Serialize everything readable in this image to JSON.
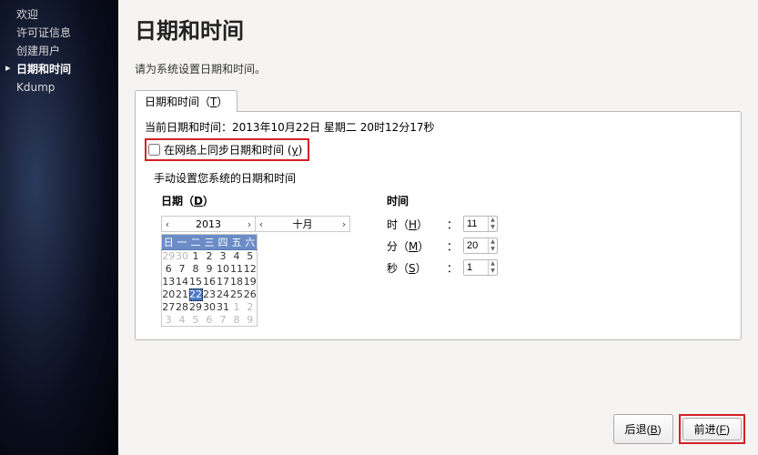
{
  "sidebar": {
    "items": [
      {
        "label": "欢迎"
      },
      {
        "label": "许可证信息"
      },
      {
        "label": "创建用户"
      },
      {
        "label": "日期和时间"
      },
      {
        "label": "Kdump"
      }
    ],
    "selected_index": 3
  },
  "page": {
    "title": "日期和时间",
    "instruction": "请为系统设置日期和时间。"
  },
  "tab": {
    "label": "日期和时间（T）",
    "hotkey": "T"
  },
  "current": {
    "label_prefix": "当前日期和时间：",
    "date": "2013年10月22日",
    "weekday": "星期二",
    "time": "20时12分17秒"
  },
  "sync": {
    "label": "在网络上同步日期和时间 (y)",
    "hotkey": "y",
    "checked": false
  },
  "manual": {
    "label": "手动设置您系统的日期和时间"
  },
  "date_section": {
    "heading": "日期（D）",
    "hotkey": "D",
    "year": "2013",
    "month": "十月",
    "dow": [
      "日",
      "一",
      "二",
      "三",
      "四",
      "五",
      "六"
    ],
    "weeks": [
      [
        {
          "d": 29,
          "o": true
        },
        {
          "d": 30,
          "o": true
        },
        {
          "d": 1
        },
        {
          "d": 2
        },
        {
          "d": 3
        },
        {
          "d": 4
        },
        {
          "d": 5
        }
      ],
      [
        {
          "d": 6
        },
        {
          "d": 7
        },
        {
          "d": 8
        },
        {
          "d": 9
        },
        {
          "d": 10
        },
        {
          "d": 11
        },
        {
          "d": 12
        }
      ],
      [
        {
          "d": 13
        },
        {
          "d": 14
        },
        {
          "d": 15
        },
        {
          "d": 16
        },
        {
          "d": 17
        },
        {
          "d": 18
        },
        {
          "d": 19
        }
      ],
      [
        {
          "d": 20
        },
        {
          "d": 21
        },
        {
          "d": 22,
          "t": true
        },
        {
          "d": 23
        },
        {
          "d": 24
        },
        {
          "d": 25
        },
        {
          "d": 26
        }
      ],
      [
        {
          "d": 27
        },
        {
          "d": 28
        },
        {
          "d": 29
        },
        {
          "d": 30
        },
        {
          "d": 31
        },
        {
          "d": 1,
          "o": true
        },
        {
          "d": 2,
          "o": true
        }
      ],
      [
        {
          "d": 3,
          "o": true
        },
        {
          "d": 4,
          "o": true
        },
        {
          "d": 5,
          "o": true
        },
        {
          "d": 6,
          "o": true
        },
        {
          "d": 7,
          "o": true
        },
        {
          "d": 8,
          "o": true
        },
        {
          "d": 9,
          "o": true
        }
      ]
    ]
  },
  "time_section": {
    "heading": "时间",
    "rows": [
      {
        "label": "时（H）",
        "hotkey": "H",
        "value": "11"
      },
      {
        "label": "分（M）",
        "hotkey": "M",
        "value": "20"
      },
      {
        "label": "秒（S）",
        "hotkey": "S",
        "value": "1"
      }
    ]
  },
  "footer": {
    "back": "后退(B)",
    "forward": "前进(F)",
    "back_hotkey": "B",
    "forward_hotkey": "F"
  }
}
